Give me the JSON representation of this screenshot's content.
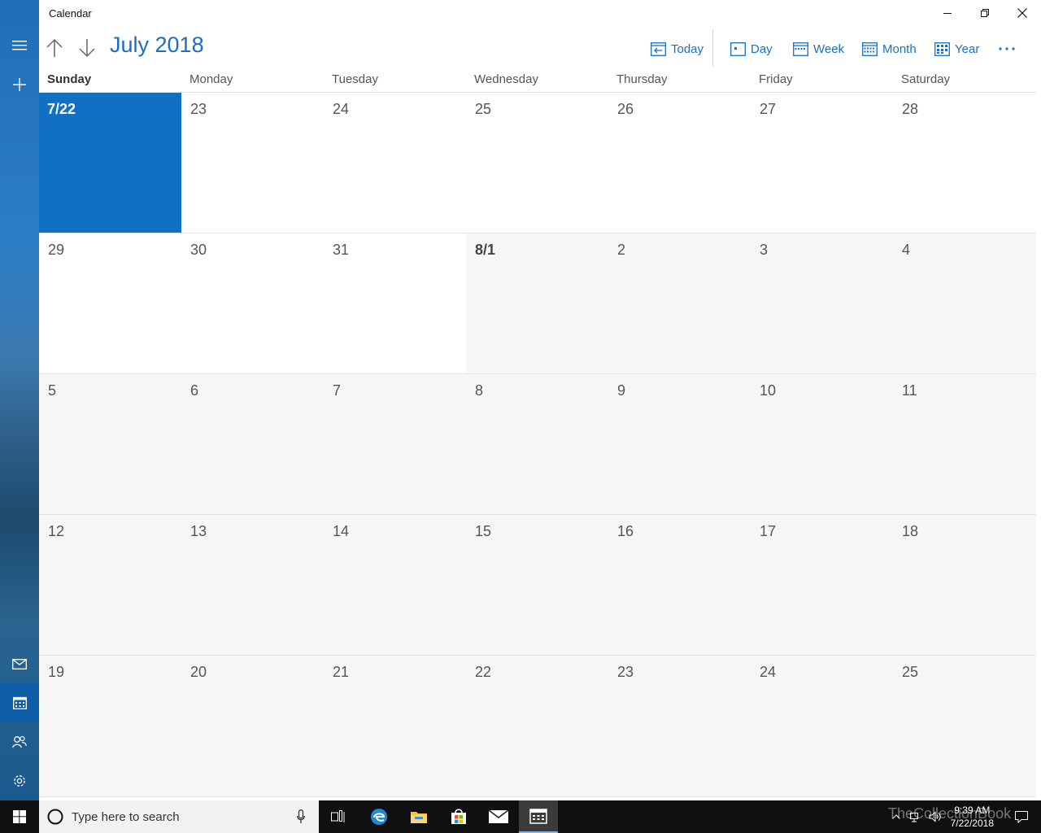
{
  "app": {
    "title": "Calendar"
  },
  "toolbar": {
    "month_title": "July 2018",
    "today_label": "Today",
    "day_label": "Day",
    "week_label": "Week",
    "month_label": "Month",
    "year_label": "Year"
  },
  "weekdays": [
    "Sunday",
    "Monday",
    "Tuesday",
    "Wednesday",
    "Thursday",
    "Friday",
    "Saturday"
  ],
  "weeks": [
    [
      "7/22",
      "23",
      "24",
      "25",
      "26",
      "27",
      "28"
    ],
    [
      "29",
      "30",
      "31",
      "8/1",
      "2",
      "3",
      "4"
    ],
    [
      "5",
      "6",
      "7",
      "8",
      "9",
      "10",
      "11"
    ],
    [
      "12",
      "13",
      "14",
      "15",
      "16",
      "17",
      "18"
    ],
    [
      "19",
      "20",
      "21",
      "22",
      "23",
      "24",
      "25"
    ]
  ],
  "taskbar": {
    "search_placeholder": "Type here to search",
    "time": "9:39 AM",
    "date": "7/22/2018",
    "watermark": "TheCollectionBook"
  },
  "colors": {
    "accent": "#1270c3",
    "title_blue": "#1a6fbf"
  }
}
